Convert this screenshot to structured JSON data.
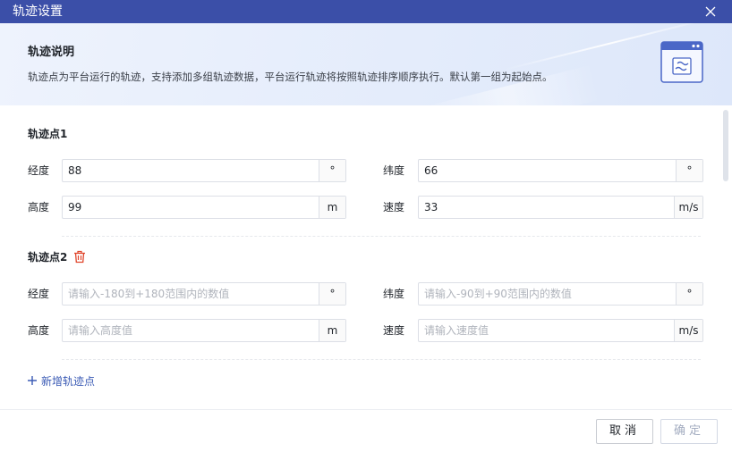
{
  "dialog": {
    "title": "轨迹设置",
    "close_icon": "close-icon"
  },
  "banner": {
    "title": "轨迹说明",
    "description": "轨迹点为平台运行的轨迹，支持添加多组轨迹数据，平台运行轨迹将按照轨迹排序顺序执行。默认第一组为起始点。",
    "icon": "document-route-icon"
  },
  "points": [
    {
      "title": "轨迹点1",
      "longitude": {
        "label": "经度",
        "value": "88",
        "placeholder": "",
        "unit": "°"
      },
      "latitude": {
        "label": "纬度",
        "value": "66",
        "placeholder": "",
        "unit": "°"
      },
      "altitude": {
        "label": "高度",
        "value": "99",
        "placeholder": "",
        "unit": "m"
      },
      "speed": {
        "label": "速度",
        "value": "33",
        "placeholder": "",
        "unit": "m/s"
      }
    },
    {
      "title": "轨迹点2",
      "delete_icon": "trash-icon",
      "longitude": {
        "label": "经度",
        "value": "",
        "placeholder": "请输入-180到+180范围内的数值",
        "unit": "°"
      },
      "latitude": {
        "label": "纬度",
        "value": "",
        "placeholder": "请输入-90到+90范围内的数值",
        "unit": "°"
      },
      "altitude": {
        "label": "高度",
        "value": "",
        "placeholder": "请输入高度值",
        "unit": "m"
      },
      "speed": {
        "label": "速度",
        "value": "",
        "placeholder": "请输入速度值",
        "unit": "m/s"
      }
    }
  ],
  "add_point_label": "新增轨迹点",
  "footer": {
    "cancel_label": "取消",
    "confirm_label": "确定"
  },
  "colors": {
    "titlebar": "#3b4fa8",
    "accent": "#3b5bb5",
    "delete": "#e0452b"
  }
}
